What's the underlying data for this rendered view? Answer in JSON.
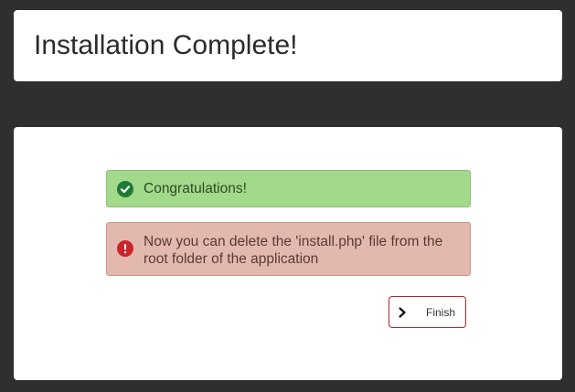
{
  "header": {
    "title": "Installation Complete!"
  },
  "alerts": {
    "success": {
      "icon": "check-circle-icon",
      "text": "Congratulations!",
      "color": "#a3d98b"
    },
    "danger": {
      "icon": "exclamation-circle-icon",
      "text": "Now you can delete the 'install.php' file from the root folder of the application",
      "color": "#e3b9af"
    }
  },
  "finish_button": {
    "icon": "chevron-right-icon",
    "label": "Finish",
    "border_color": "#b8252c"
  },
  "colors": {
    "page_background": "#2f2f2f",
    "card_background": "#ffffff"
  }
}
